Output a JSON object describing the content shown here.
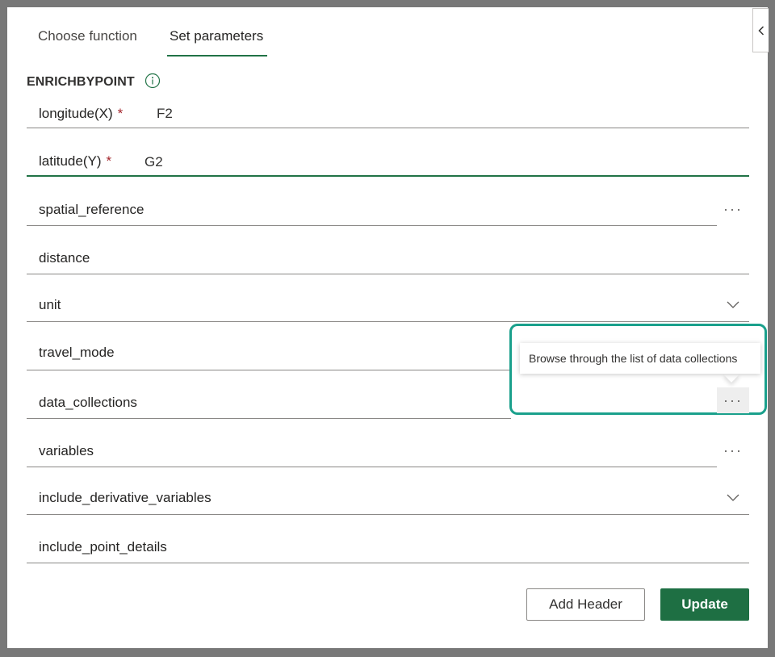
{
  "tabs": {
    "choose_function": "Choose function",
    "set_parameters": "Set parameters"
  },
  "function_name": "ENRICHBYPOINT",
  "fields": [
    {
      "label": "longitude(X)",
      "required": "*",
      "value": "F2"
    },
    {
      "label": "latitude(Y)",
      "required": "*",
      "value": "G2"
    },
    {
      "label": "spatial_reference"
    },
    {
      "label": "distance"
    },
    {
      "label": "unit"
    },
    {
      "label": "travel_mode"
    },
    {
      "label": "data_collections"
    },
    {
      "label": "variables"
    },
    {
      "label": "include_derivative_variables"
    },
    {
      "label": "include_point_details"
    }
  ],
  "more_glyph": "···",
  "tooltip": "Browse through the list of data collections",
  "buttons": {
    "add_header": "Add Header",
    "update": "Update"
  },
  "colors": {
    "accent": "#217346",
    "primary_button": "#1e6f43",
    "callout_border": "#1aa08c",
    "required": "#a4262c"
  },
  "icons": [
    "info-icon",
    "chevron-left-icon",
    "chevron-down-icon",
    "more-icon"
  ]
}
